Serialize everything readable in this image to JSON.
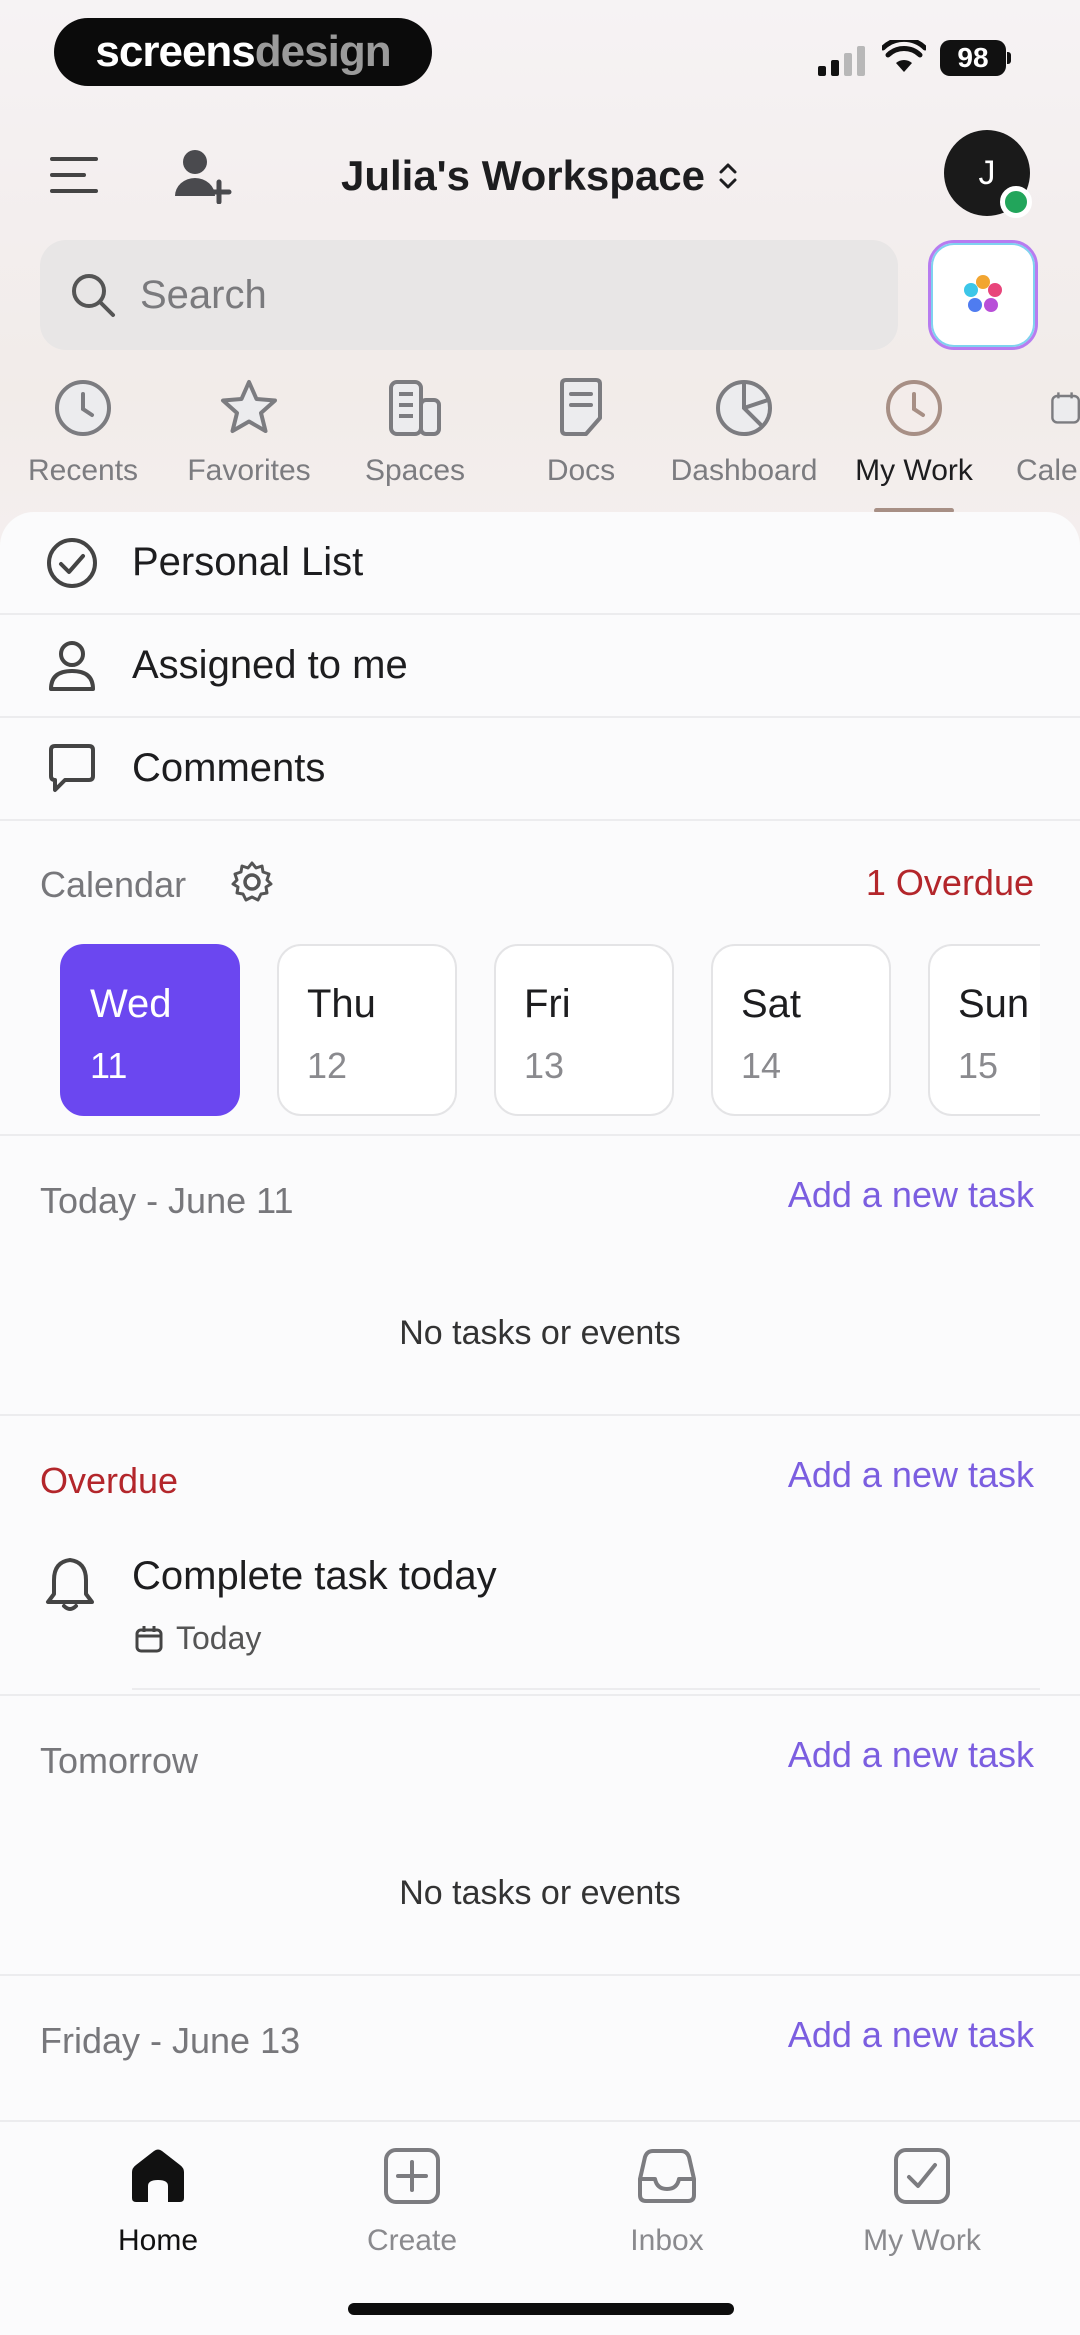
{
  "status_bar": {
    "brand_part1": "screens",
    "brand_part2": "design",
    "battery": "98"
  },
  "header": {
    "workspace_name": "Julia's Workspace",
    "avatar_initial": "J"
  },
  "search": {
    "placeholder": "Search"
  },
  "nav_tabs": [
    {
      "label": "Recents",
      "icon": "clock-icon"
    },
    {
      "label": "Favorites",
      "icon": "star-icon"
    },
    {
      "label": "Spaces",
      "icon": "spaces-icon"
    },
    {
      "label": "Docs",
      "icon": "doc-icon"
    },
    {
      "label": "Dashboard",
      "icon": "pie-chart-icon"
    },
    {
      "label": "My Work",
      "icon": "clock-icon",
      "active": true
    },
    {
      "label": "Cale",
      "icon": "calendar-icon"
    }
  ],
  "menu": [
    {
      "label": "Personal List",
      "icon": "check-circle-icon"
    },
    {
      "label": "Assigned to me",
      "icon": "user-icon"
    },
    {
      "label": "Comments",
      "icon": "comment-icon"
    }
  ],
  "calendar": {
    "title": "Calendar",
    "overdue_badge": "1 Overdue",
    "days": [
      {
        "name": "Wed",
        "num": "11",
        "selected": true
      },
      {
        "name": "Thu",
        "num": "12"
      },
      {
        "name": "Fri",
        "num": "13"
      },
      {
        "name": "Sat",
        "num": "14"
      },
      {
        "name": "Sun",
        "num": "15"
      }
    ]
  },
  "sections": {
    "today": {
      "title": "Today - June 11",
      "add": "Add a new task",
      "empty": "No tasks or events"
    },
    "overdue": {
      "title": "Overdue",
      "add": "Add a new task",
      "task": {
        "title": "Complete task today",
        "due": "Today"
      }
    },
    "tomorrow": {
      "title": "Tomorrow",
      "add": "Add a new task",
      "empty": "No tasks or events"
    },
    "friday": {
      "title": "Friday - June 13",
      "add": "Add a new task"
    }
  },
  "bottom_nav": [
    {
      "label": "Home",
      "icon": "home-icon",
      "active": true
    },
    {
      "label": "Create",
      "icon": "plus-square-icon"
    },
    {
      "label": "Inbox",
      "icon": "inbox-icon"
    },
    {
      "label": "My Work",
      "icon": "check-square-icon"
    }
  ],
  "colors": {
    "accent": "#6b47f0",
    "link": "#7b5ee0",
    "overdue": "#b3262b"
  }
}
